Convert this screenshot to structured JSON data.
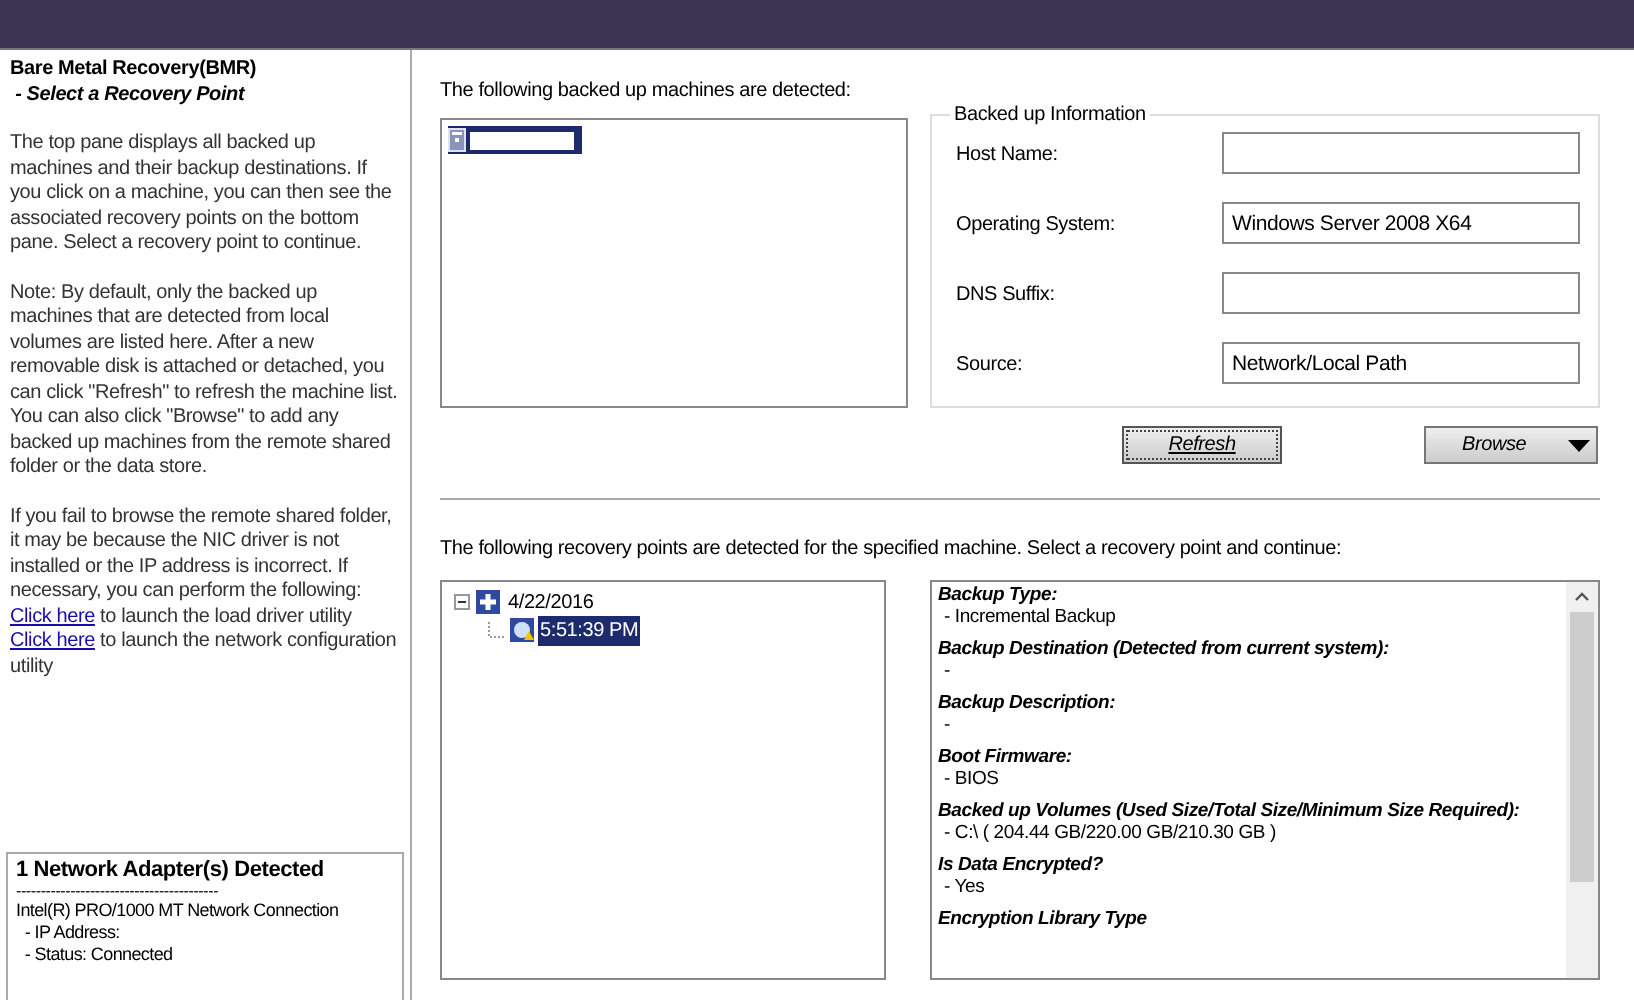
{
  "sidebar": {
    "title": "Bare Metal Recovery(BMR)",
    "subtitle": " - Select a Recovery Point",
    "paragraphs": [
      "The top pane displays all backed up machines and their backup destinations. If you click on a machine, you can then see the associated recovery points on the bottom pane. Select a recovery point to continue.",
      "Note: By default, only the backed up machines that are detected from local volumes are listed here. After a new removable disk is attached or detached, you can click \"Refresh\" to refresh the machine list.\nYou can also click \"Browse\" to add any backed up machines from the remote shared folder or the data store.",
      "If you fail to browse the remote shared folder, it may be because the NIC driver is not installed or the IP address is incorrect. If necessary, you can perform the following:"
    ],
    "links": [
      {
        "link": "Click here",
        "text": " to launch the load driver utility"
      },
      {
        "link": "Click here",
        "text": " to launch the network configuration utility"
      }
    ],
    "adapters": {
      "title": "1 Network Adapter(s) Detected",
      "separator": "-----------------------------------------",
      "lines": [
        "Intel(R) PRO/1000 MT Network Connection",
        "  - IP Address:",
        "  - Status: Connected"
      ]
    }
  },
  "machines": {
    "label": "The following backed up machines are detected:",
    "items": [
      {
        "selected": true
      }
    ]
  },
  "info": {
    "title": "Backed up Information",
    "fields": [
      {
        "label": "Host Name:"
      },
      {
        "label": "Operating System:",
        "value": "Windows Server 2008 X64"
      },
      {
        "label": "DNS Suffix:"
      },
      {
        "label": "Source:",
        "value": "Network/Local Path"
      }
    ]
  },
  "buttons": {
    "refresh": "Refresh",
    "browse": "Browse"
  },
  "recovery": {
    "label": "The following recovery points are detected for the specified machine. Select a recovery point and continue:",
    "tree": [
      {
        "label": "4/22/2016",
        "expanded": true,
        "selected": false,
        "children": [
          {
            "label": "5:51:39 PM",
            "selected": true
          }
        ]
      }
    ],
    "details": [
      {
        "heading": "Backup Type:",
        "value": "- Incremental Backup"
      },
      {
        "heading": "Backup Destination (Detected from current system):",
        "value": "-"
      },
      {
        "heading": "Backup Description:",
        "value": "-"
      },
      {
        "heading": "Boot Firmware:",
        "value": "- BIOS"
      },
      {
        "heading": "Backed up Volumes (Used Size/Total Size/Minimum Size Required):",
        "value": "- C:\\ ( 204.44 GB/220.00 GB/210.30 GB )"
      },
      {
        "heading": "Is Data Encrypted?",
        "value": "- Yes"
      },
      {
        "heading": "Encryption Library Type"
      }
    ]
  }
}
